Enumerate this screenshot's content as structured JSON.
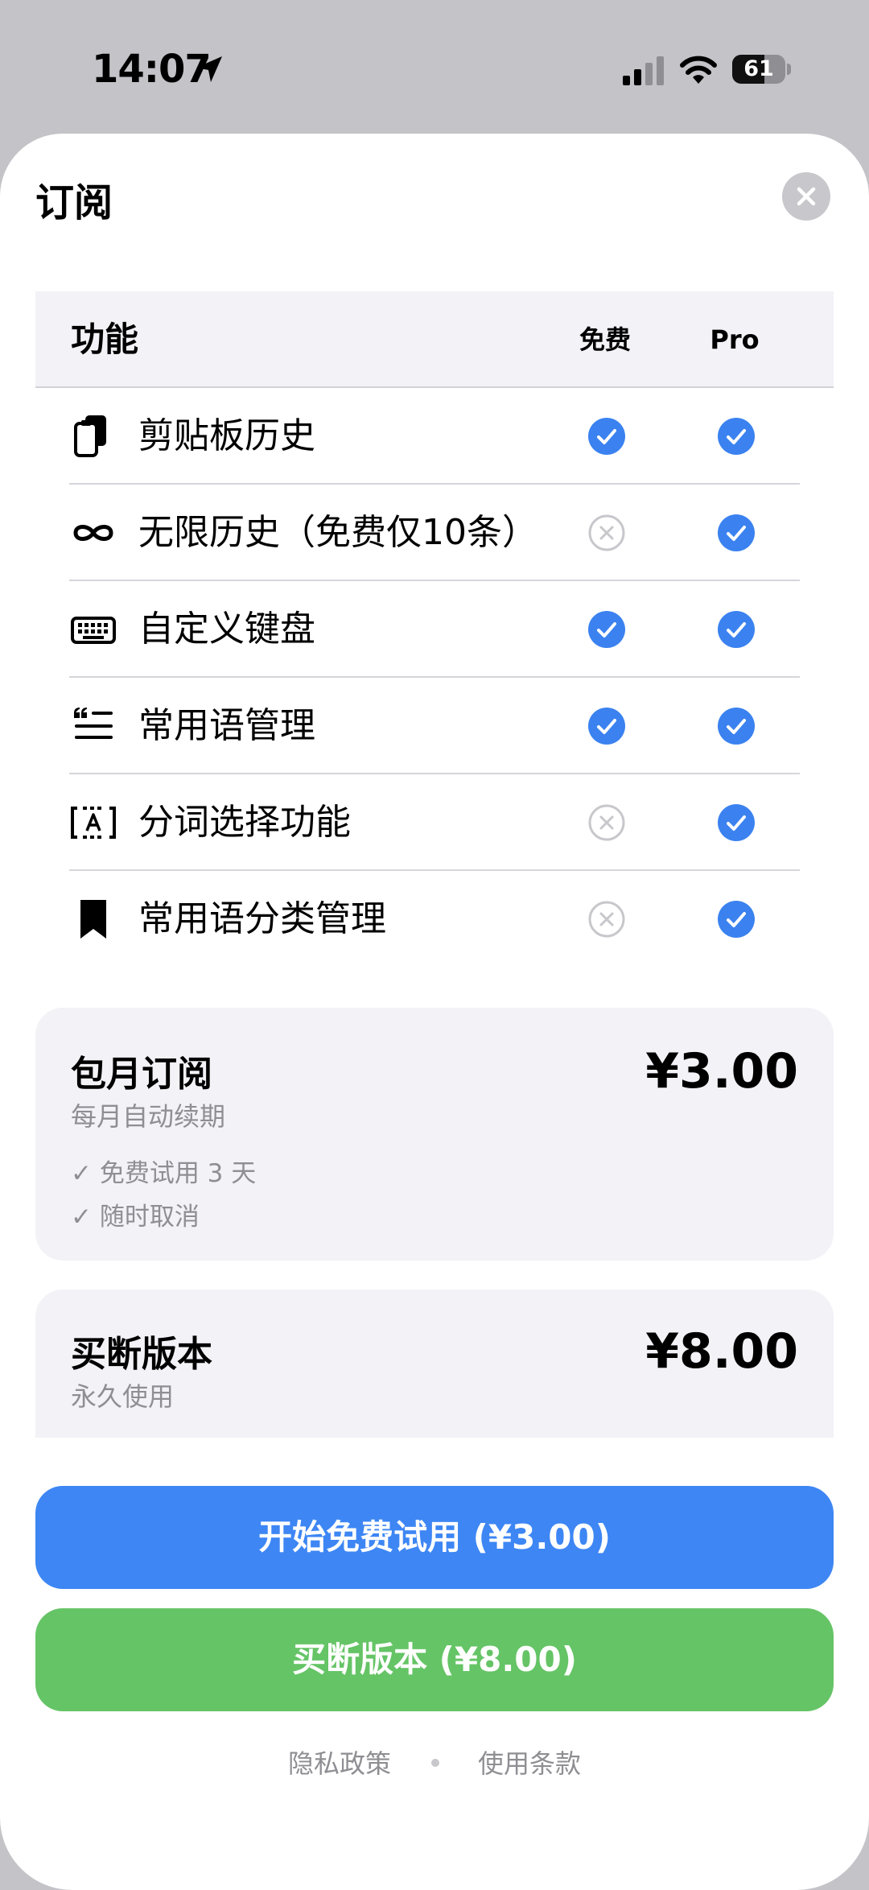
{
  "status_bar": {
    "time": "14:07",
    "battery": "61",
    "battery_level": 0.61
  },
  "sheet": {
    "title": "订阅"
  },
  "features": {
    "header": {
      "feature": "功能",
      "free": "免费",
      "pro": "Pro"
    },
    "rows": [
      {
        "label": "剪贴板历史",
        "icon": "clipboard-icon",
        "free": true,
        "pro": true
      },
      {
        "label": "无限历史（免费仅10条）",
        "icon": "infinity-icon",
        "free": false,
        "pro": true
      },
      {
        "label": "自定义键盘",
        "icon": "keyboard-icon",
        "free": true,
        "pro": true
      },
      {
        "label": "常用语管理",
        "icon": "text-quote-icon",
        "free": true,
        "pro": true
      },
      {
        "label": "分词选择功能",
        "icon": "text-select-icon",
        "free": false,
        "pro": true
      },
      {
        "label": "常用语分类管理",
        "icon": "bookmark-icon",
        "free": false,
        "pro": true
      }
    ]
  },
  "plans": {
    "monthly": {
      "name": "包月订阅",
      "subtitle": "每月自动续期",
      "price": "¥3.00",
      "bullets": [
        "✓ 免费试用 3 天",
        "✓ 随时取消"
      ]
    },
    "lifetime": {
      "name": "买断版本",
      "subtitle": "永久使用",
      "price": "¥8.00"
    }
  },
  "buttons": {
    "trial": "开始免费试用 (¥3.00)",
    "buy": "买断版本 (¥8.00)"
  },
  "footer": {
    "privacy": "隐私政策",
    "terms": "使用条款"
  },
  "colors": {
    "accent_blue": "#3d86f4",
    "accent_green": "#65c466",
    "check_blue": "#3b82f0",
    "cross_gray": "#c7c7cc",
    "card_bg": "#f2f2f7",
    "secondary_text": "#8e8e93"
  }
}
